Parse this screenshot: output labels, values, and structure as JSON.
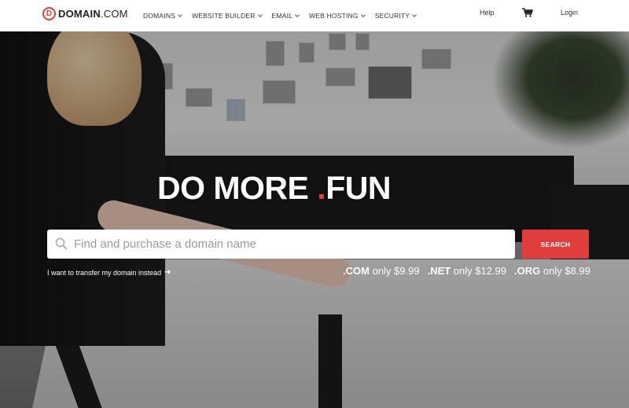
{
  "nav": {
    "logo_mark": "D",
    "logo_brand": "DOMAIN",
    "logo_tld": ".COM",
    "menu": [
      {
        "label": "DOMAINS"
      },
      {
        "label": "WEBSITE BUILDER"
      },
      {
        "label": "EMAIL"
      },
      {
        "label": "WEB HOSTING"
      },
      {
        "label": "SECURITY"
      }
    ],
    "help": "Help",
    "cart_icon": "shopping-cart-icon",
    "login": "Login"
  },
  "hero": {
    "headline_main": "DO MORE ",
    "headline_dot": ".",
    "headline_tld": "FUN",
    "search": {
      "placeholder": "Find and purchase a domain name",
      "button": "SEARCH"
    },
    "transfer_link": "I want to transfer my domain instead",
    "prices": [
      {
        "tld": ".COM",
        "text": " only $9.99"
      },
      {
        "tld": ".NET",
        "text": " only $12.99"
      },
      {
        "tld": ".ORG",
        "text": " only $8.99"
      }
    ]
  },
  "colors": {
    "accent": "#e03d3d"
  }
}
